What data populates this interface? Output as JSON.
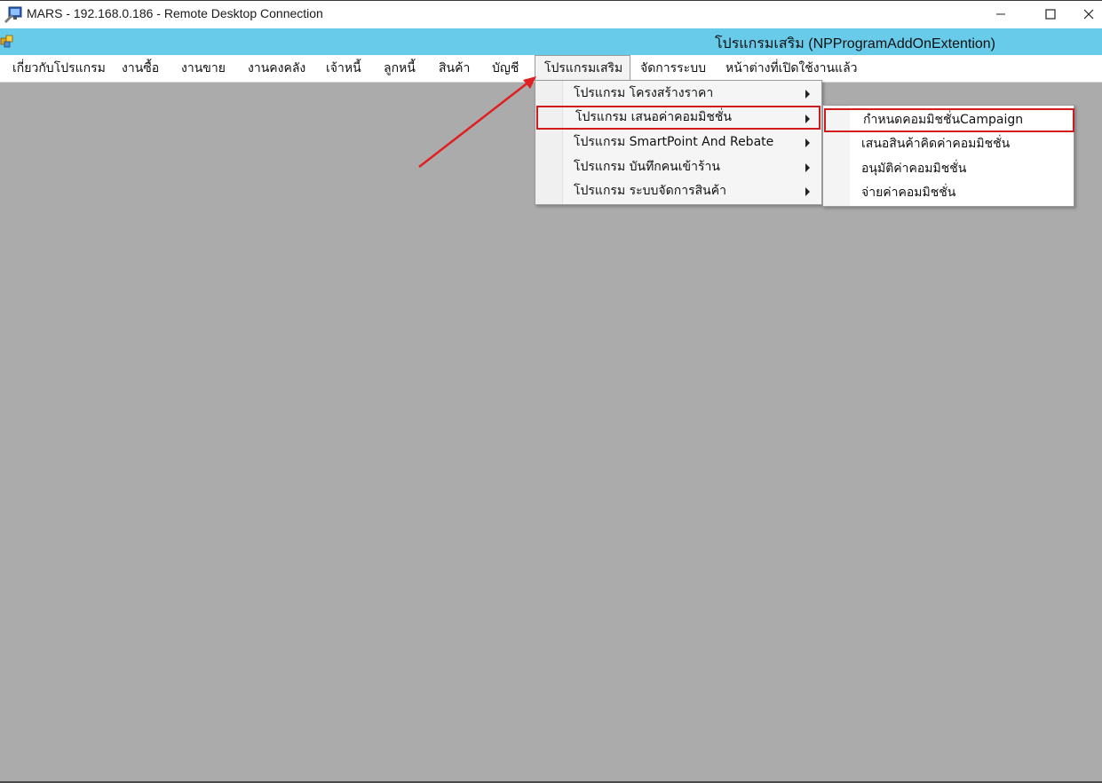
{
  "rdp_window": {
    "title": "MARS - 192.168.0.186 - Remote Desktop Connection",
    "icon": "remote-desktop-icon",
    "controls": [
      "minimize-icon",
      "maximize-icon",
      "close-icon"
    ]
  },
  "app_window": {
    "title": "โปรแกรมเสริม (NPProgramAddOnExtention)",
    "icon": "app-icon"
  },
  "menubar": {
    "items": [
      {
        "label": "เกี่ยวกับโปรแกรม"
      },
      {
        "label": "งานซื้อ"
      },
      {
        "label": "งานขาย"
      },
      {
        "label": "งานคงคลัง"
      },
      {
        "label": "เจ้าหนี้"
      },
      {
        "label": "ลูกหนี้"
      },
      {
        "label": "สินค้า"
      },
      {
        "label": "บัญชี"
      },
      {
        "label": "โปรแกรมเสริม",
        "active": true
      },
      {
        "label": "จัดการระบบ"
      },
      {
        "label": "หน้าต่างที่เปิดใช้งานแล้ว"
      }
    ]
  },
  "dropdown": {
    "items": [
      {
        "label": "โปรแกรม โครงสร้างราคา",
        "has_submenu": true
      },
      {
        "label": "โปรแกรม เสนอค่าคอมมิชชั่น",
        "has_submenu": true,
        "highlighted": true
      },
      {
        "label": "โปรแกรม SmartPoint And Rebate",
        "has_submenu": true
      },
      {
        "label": "โปรแกรม บันทึกคนเข้าร้าน",
        "has_submenu": true
      },
      {
        "label": "โปรแกรม ระบบจัดการสินค้า",
        "has_submenu": true
      }
    ]
  },
  "submenu": {
    "items": [
      {
        "label": "กำหนดคอมมิชชั่นCampaign",
        "highlighted": true
      },
      {
        "label": "เสนอสินค้าคิดค่าคอมมิชชั่น"
      },
      {
        "label": "อนุมัติค่าคอมมิชชั่น"
      },
      {
        "label": "จ่ายค่าคอมมิชชั่น"
      }
    ]
  },
  "annotation": {
    "type": "arrow",
    "color": "#e02020"
  },
  "colors": {
    "app_titlebar": "#68cbe9",
    "workspace": "#ababab",
    "highlight_border": "#d01c1c"
  }
}
